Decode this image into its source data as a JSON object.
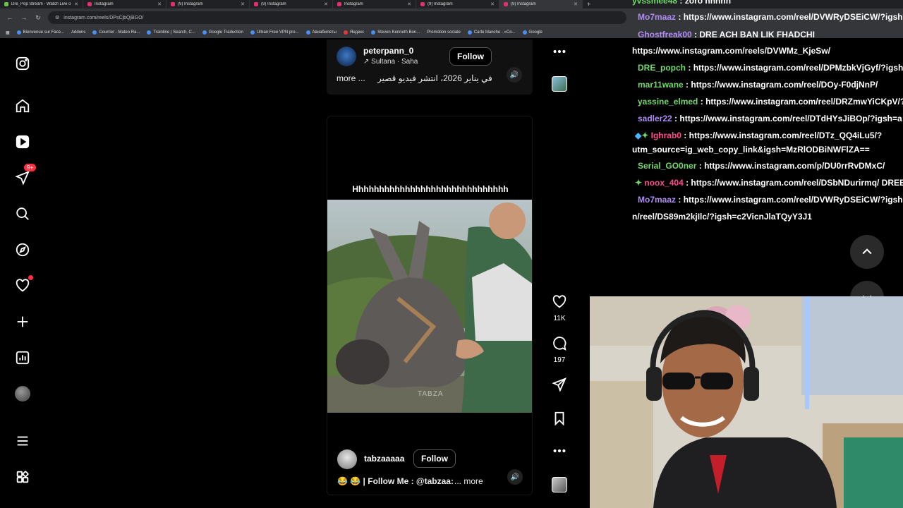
{
  "browser": {
    "tabs": [
      {
        "label": "Dre_Pop Stream - Watch Live o"
      },
      {
        "label": "Instagram"
      },
      {
        "label": "(9) Instagram"
      },
      {
        "label": "(9) Instagram"
      },
      {
        "label": "Instagram"
      },
      {
        "label": "(9) Instagram"
      },
      {
        "label": "(9) Instagram"
      }
    ],
    "url": "instagram.com/reels/DPsCjbQjBGO/",
    "bookmarks": [
      "Bienvenue sur Face...",
      "Addons",
      "Courrier - Mateo Ra...",
      "Trainline | Search, C...",
      "Google Traduction",
      "Urban Free VPN pro...",
      "Авиабилеты",
      "Яндекс",
      "Steven Kenneth Bon...",
      "Promotion sociale",
      "Carte blanche - «Co...",
      "Google"
    ]
  },
  "nav": {
    "notif_badge": "9+"
  },
  "reel_top": {
    "username": "peterpann_0",
    "audio": "Sultana · Saha",
    "follow": "Follow",
    "caption_more": "more ...",
    "caption": "في يناير 2026، انتشر فيديو قصير"
  },
  "reel_main": {
    "video_title": "Hhhhhhhhhhhhhhhhhhhhhhhhhhhhhh",
    "watermark": "TABZA",
    "username": "tabzaaaaa",
    "follow": "Follow",
    "caption": "😂 😂 | Follow Me : @tabzaa:",
    "caption_more": "... more"
  },
  "rail": {
    "likes": "11K",
    "comments": "197"
  },
  "chat": [
    {
      "user": "yvssmee48",
      "sep": " : ",
      "text": "zoro hhhhh",
      "color": "green"
    },
    {
      "user": "Mo7maaz",
      "sep": " : ",
      "text": "https://www.instagram.com/reel/DVWRyDSEiCW/?igsh",
      "color": "purple"
    },
    {
      "user": "Ghostfreak00",
      "sep": " : ",
      "text": "DRE ACH BAN LIK FHADCHI",
      "color": "purple"
    },
    {
      "user": "",
      "sep": "",
      "text": "https://www.instagram.com/reels/DVWMz_KjeSw/",
      "color": ""
    },
    {
      "user": "DRE_popch",
      "sep": " : ",
      "text": "https://www.instagram.com/reel/DPMzbkVjGyf/?igsh",
      "color": "green"
    },
    {
      "user": "mar11wane",
      "sep": " : ",
      "text": "https://www.instagram.com/reel/DOy-F0djNnP/",
      "color": "green"
    },
    {
      "user": "yassine_elmed",
      "sep": " : ",
      "text": "https://www.instagram.com/reel/DRZmwYiCKpV/?",
      "color": "green"
    },
    {
      "user": "sadler22",
      "sep": " : ",
      "text": "https://www.instagram.com/reel/DTdHYsJiBOp/?igsh=a",
      "color": "purple"
    },
    {
      "user": "Ighrab0",
      "sep": " : ",
      "text": "https://www.instagram.com/reel/DTz_QQ4iLu5/?",
      "color": "pink"
    },
    {
      "user": "",
      "sep": "",
      "text": "utm_source=ig_web_copy_link&igsh=MzRlODBiNWFlZA==",
      "color": ""
    },
    {
      "user": "Serial_GO0ner",
      "sep": " : ",
      "text": "https://www.instagram.com/p/DU0rrRvDMxC/",
      "color": "green"
    },
    {
      "user": "noox_404",
      "sep": " : ",
      "text": "https://www.instagram.com/reel/DSbNDurirmq/ DREE",
      "color": "pink"
    },
    {
      "user": "Mo7maaz",
      "sep": " : ",
      "text": "https://www.instagram.com/reel/DVWRyDSEiCW/?igsh",
      "color": "purple"
    },
    {
      "user": "",
      "sep": "",
      "text": "n/reel/DS89m2kjIlc/?igsh=c2VicnJlaTQyY3J1",
      "color": ""
    }
  ]
}
